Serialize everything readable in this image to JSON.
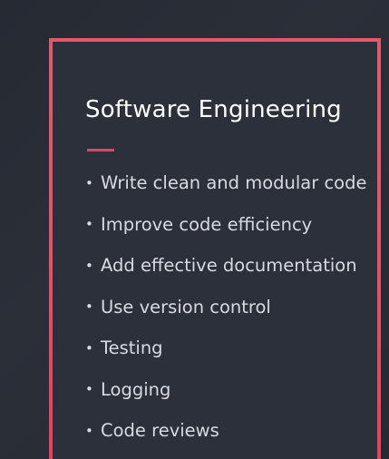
{
  "slide": {
    "title": "Software Engineering",
    "bullets": [
      "Write clean and modular code",
      "Improve code efficiency",
      "Add effective documentation",
      "Use version control",
      "Testing",
      "Logging",
      "Code reviews"
    ]
  },
  "icons": {
    "bullet": "bullet-dot-icon"
  },
  "colors": {
    "background": "#252a33",
    "card": "#2b303a",
    "accent": "#e3596c",
    "text": "#d7dae0"
  }
}
